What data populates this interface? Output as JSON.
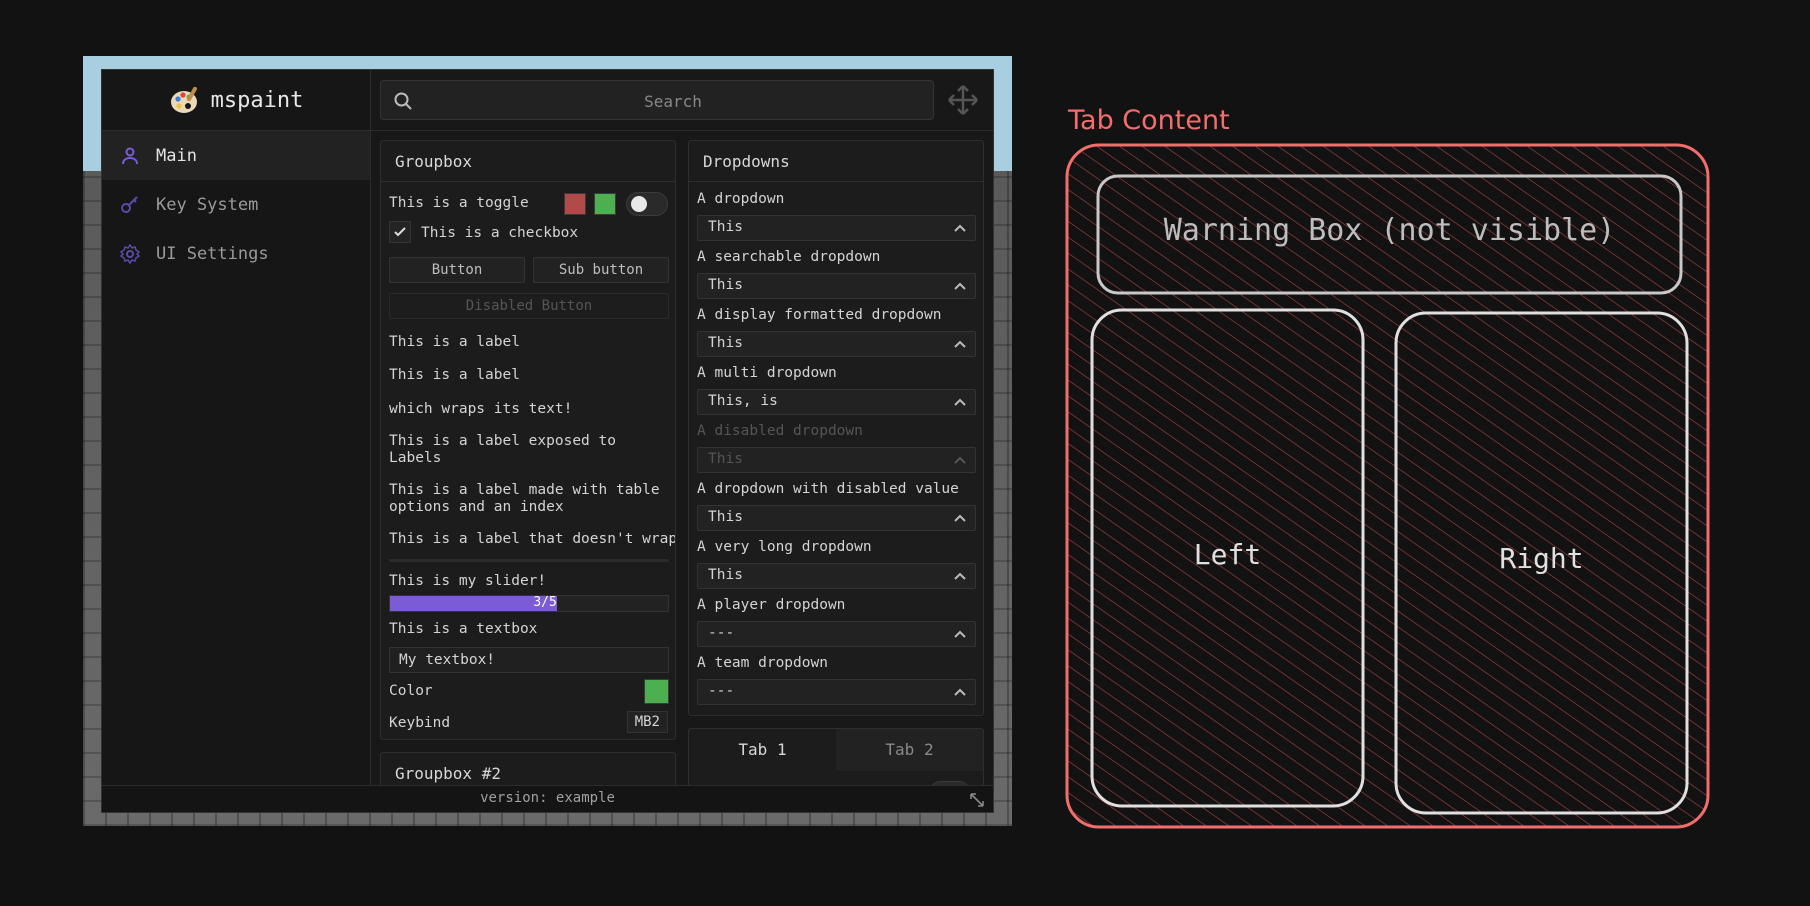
{
  "app": {
    "title": "mspaint"
  },
  "search": {
    "placeholder": "Search"
  },
  "sidebar": {
    "items": [
      {
        "label": "Main",
        "icon": "user-icon"
      },
      {
        "label": "Key System",
        "icon": "key-icon"
      },
      {
        "label": "UI Settings",
        "icon": "gear-icon"
      }
    ]
  },
  "groupbox": {
    "title": "Groupbox",
    "toggle_label": "This is a toggle",
    "toggle_colors": [
      "#b24a4a",
      "#4caf50"
    ],
    "checkbox_label": "This is a checkbox",
    "button_label": "Button",
    "sub_button_label": "Sub button",
    "disabled_button_label": "Disabled Button",
    "labels": [
      "This is a label",
      "This is a label",
      "which wraps its text!",
      "This is a label exposed to Labels",
      "This is a label made with table options and an index",
      "This is a label that doesn't wrap"
    ],
    "slider_label": "This is my slider!",
    "slider_value": 3,
    "slider_max": 5,
    "slider_text": "3/5",
    "textbox_label": "This is a textbox",
    "textbox_value": "My textbox!",
    "color_label": "Color",
    "color_value": "#4caf50",
    "keybind_label": "Keybind",
    "keybind_value": "MB2"
  },
  "groupbox2": {
    "title": "Groupbox #2"
  },
  "dropdowns": {
    "title": "Dropdowns",
    "items": [
      {
        "label": "A dropdown",
        "value": "This"
      },
      {
        "label": "A searchable dropdown",
        "value": "This"
      },
      {
        "label": "A display formatted dropdown",
        "value": "This"
      },
      {
        "label": "A multi dropdown",
        "value": "This, is"
      },
      {
        "label": "A disabled dropdown",
        "value": "This",
        "disabled": true
      },
      {
        "label": "A dropdown with disabled value",
        "value": "This"
      },
      {
        "label": "A very long dropdown",
        "value": "This"
      },
      {
        "label": "A player dropdown",
        "value": "---"
      },
      {
        "label": "A team dropdown",
        "value": "---"
      }
    ]
  },
  "tabbox": {
    "tabs": [
      "Tab 1",
      "Tab 2"
    ]
  },
  "footer": {
    "version": "version: example"
  },
  "accent_color": "#7b5cd6",
  "diagram": {
    "title": "Tab Content",
    "warning": "Warning Box (not visible)",
    "left": "Left",
    "right": "Right",
    "color": "#f26d6d"
  }
}
